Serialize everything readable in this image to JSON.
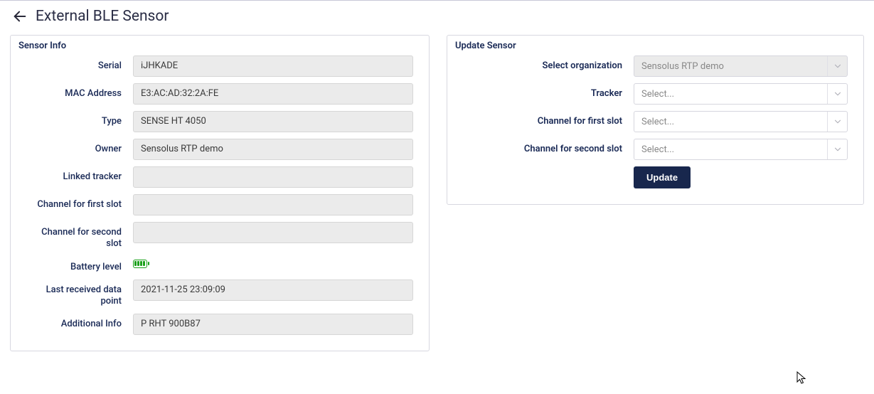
{
  "header": {
    "title": "External BLE Sensor"
  },
  "sensor_info": {
    "panel_title": "Sensor Info",
    "fields": {
      "serial_label": "Serial",
      "serial_value": "iJHKADE",
      "mac_label": "MAC Address",
      "mac_value": "E3:AC:AD:32:2A:FE",
      "type_label": "Type",
      "type_value": "SENSE HT 4050",
      "owner_label": "Owner",
      "owner_value": "Sensolus RTP demo",
      "linked_tracker_label": "Linked tracker",
      "linked_tracker_value": "",
      "ch1_label": "Channel for first slot",
      "ch1_value": "",
      "ch2_label": "Channel for second slot",
      "ch2_value": "",
      "battery_label": "Battery level",
      "last_data_label": "Last received data point",
      "last_data_value": "2021-11-25 23:09:09",
      "additional_label": "Additional Info",
      "additional_value": "P RHT 900B87"
    }
  },
  "update_sensor": {
    "panel_title": "Update Sensor",
    "org_label": "Select organization",
    "org_value": "Sensolus RTP demo",
    "tracker_label": "Tracker",
    "tracker_placeholder": "Select...",
    "ch1_label": "Channel for first slot",
    "ch1_placeholder": "Select...",
    "ch2_label": "Channel for second slot",
    "ch2_placeholder": "Select...",
    "update_button": "Update"
  }
}
